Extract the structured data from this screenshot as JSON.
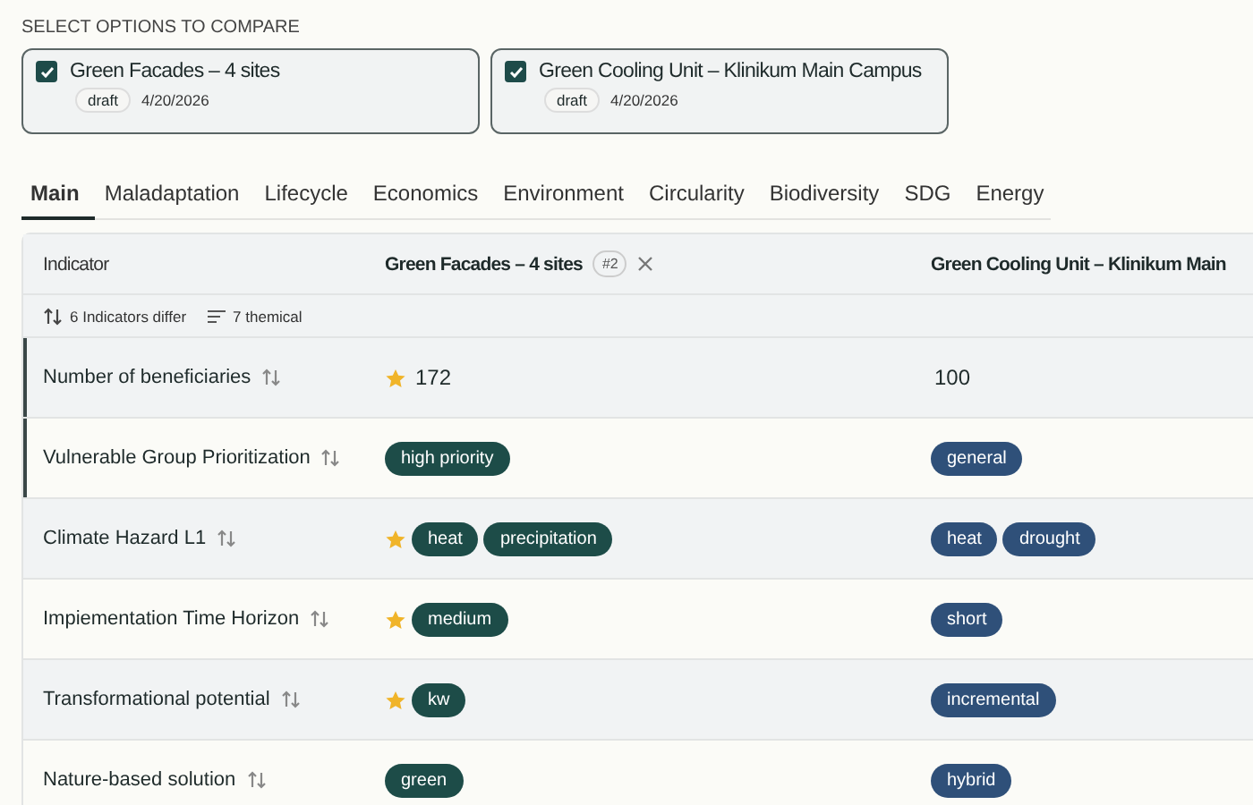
{
  "section_label": "SELECT OPTIONS TO COMPARE",
  "options": [
    {
      "title": "Green Facades – 4 sites",
      "checked": true,
      "status": "draft",
      "date": "4/20/2026"
    },
    {
      "title": "Green Cooling Unit – Klinikum Main Campus",
      "checked": true,
      "status": "draft",
      "date": "4/20/2026"
    }
  ],
  "tabs": [
    {
      "label": "Main",
      "selected": true
    },
    {
      "label": "Maladaptation",
      "selected": false
    },
    {
      "label": "Lifecycle",
      "selected": false
    },
    {
      "label": "Economics",
      "selected": false
    },
    {
      "label": "Environment",
      "selected": false
    },
    {
      "label": "Circularity",
      "selected": false
    },
    {
      "label": "Biodiversity",
      "selected": false
    },
    {
      "label": "SDG",
      "selected": false
    },
    {
      "label": "Energy",
      "selected": false
    }
  ],
  "table": {
    "columns": [
      {
        "title": "Indicator",
        "removable": false
      },
      {
        "title": "Green Facades – 4 sites",
        "rank": "#2",
        "removable": true
      },
      {
        "title": "Green Cooling Unit – Klinikum Main",
        "removable": false
      }
    ],
    "summary": {
      "differ": "6 Indicators differ",
      "themical": "7 themical"
    },
    "rows": [
      {
        "highlighted": true,
        "cells": [
          {
            "kind": "indicator",
            "text": "Number of beneficiaries"
          },
          {
            "kind": "text",
            "best": true,
            "text": "172"
          },
          {
            "kind": "text",
            "best": false,
            "text": "100"
          }
        ]
      },
      {
        "highlighted": true,
        "cells": [
          {
            "kind": "indicator",
            "text": "Vulnerable Group Prioritization"
          },
          {
            "kind": "tags",
            "best": false,
            "tags": [
              "high priority"
            ]
          },
          {
            "kind": "tags",
            "best": false,
            "tags": [
              "general"
            ]
          }
        ]
      },
      {
        "highlighted": false,
        "cells": [
          {
            "kind": "indicator",
            "text": "Climate Hazard L1"
          },
          {
            "kind": "tags",
            "best": true,
            "tags": [
              "heat",
              "precipitation"
            ]
          },
          {
            "kind": "tags",
            "best": false,
            "tags": [
              "heat",
              "drought"
            ]
          }
        ]
      },
      {
        "highlighted": false,
        "cells": [
          {
            "kind": "indicator",
            "text": "Impiementation Time Horizon"
          },
          {
            "kind": "tags",
            "best": true,
            "tags": [
              "medium"
            ]
          },
          {
            "kind": "tags",
            "best": false,
            "tags": [
              "short"
            ]
          }
        ]
      },
      {
        "highlighted": false,
        "cells": [
          {
            "kind": "indicator",
            "text": "Transformational potential"
          },
          {
            "kind": "tags",
            "best": true,
            "tags": [
              "kw"
            ]
          },
          {
            "kind": "tags",
            "best": false,
            "tags": [
              "incremental"
            ]
          }
        ]
      },
      {
        "highlighted": false,
        "cells": [
          {
            "kind": "indicator",
            "text": "Nature-based solution"
          },
          {
            "kind": "tags",
            "best": false,
            "tags": [
              "green"
            ]
          },
          {
            "kind": "tags",
            "best": false,
            "tags": [
              "hybrid"
            ]
          }
        ]
      }
    ]
  }
}
